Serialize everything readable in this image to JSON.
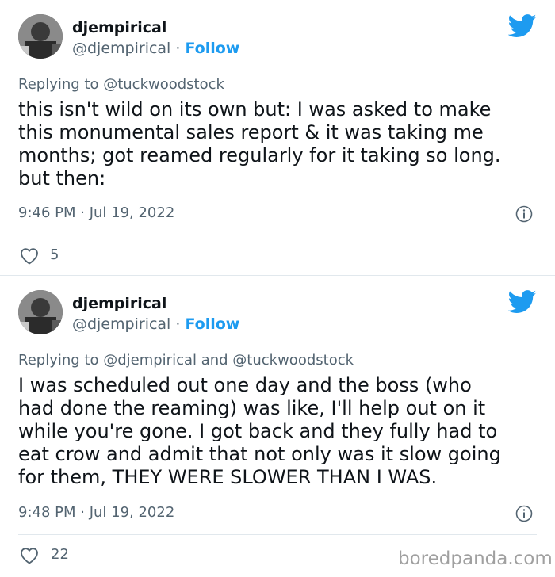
{
  "tweets": [
    {
      "name": "djempirical",
      "handle": "@djempirical",
      "separator": " · ",
      "follow": "Follow",
      "reply_prefix": "Replying to ",
      "reply_to": "@tuckwoodstock",
      "lines": [
        "this isn't wild on its own but: I was asked to make",
        "this monumental sales report & it was taking me",
        "months; got reamed regularly for it taking so long.",
        "but then:"
      ],
      "timestamp": "9:46 PM · Jul 19, 2022",
      "likes": "5"
    },
    {
      "name": "djempirical",
      "handle": "@djempirical",
      "separator": " · ",
      "follow": "Follow",
      "reply_prefix": "Replying to ",
      "reply_to": "@djempirical and @tuckwoodstock",
      "lines": [
        "I was scheduled out one day and the boss (who",
        "had done the reaming) was like, I'll help out on it",
        "while you're gone. I got back and they fully had to",
        "eat crow and admit that not only was it slow going",
        "for them, THEY WERE SLOWER THAN I WAS."
      ],
      "timestamp": "9:48 PM · Jul 19, 2022",
      "likes": "22"
    }
  ],
  "watermark": "boredpanda.com",
  "colors": {
    "follow": "#1d9bf0",
    "muted": "#536471",
    "text": "#0f1419",
    "twitter_blue": "#1d9bf0"
  },
  "icons": [
    "avatar",
    "twitter-bird-icon",
    "info-icon",
    "heart-icon"
  ]
}
